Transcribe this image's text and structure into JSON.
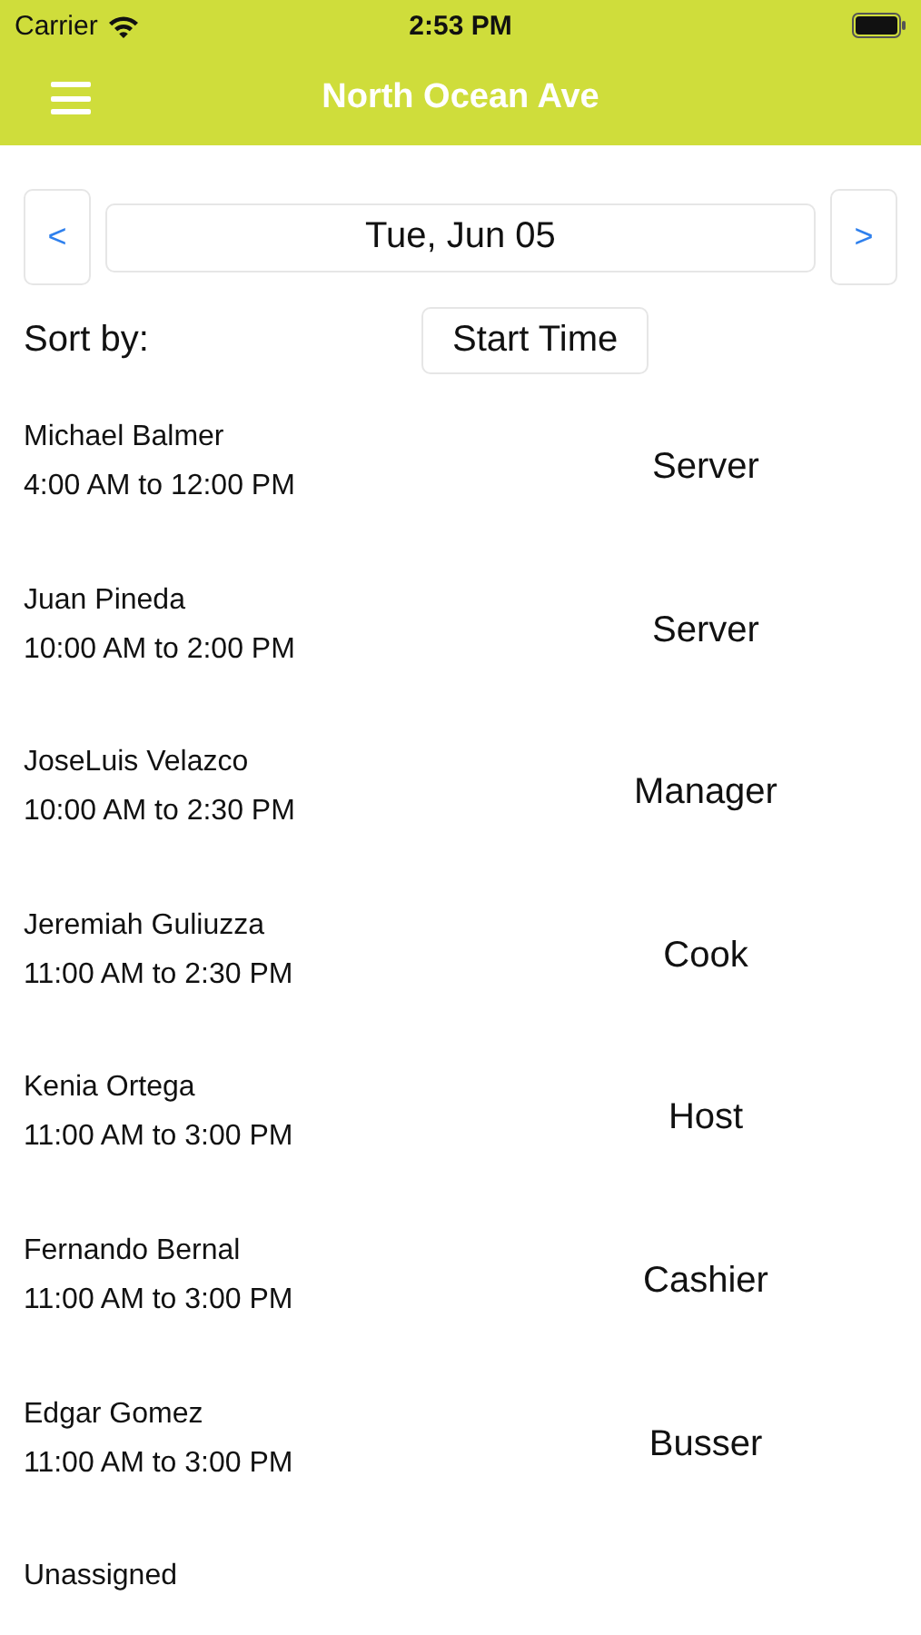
{
  "status_bar": {
    "carrier": "Carrier",
    "time": "2:53 PM"
  },
  "header": {
    "title": "North Ocean Ave"
  },
  "date_nav": {
    "prev": "<",
    "date": "Tue, Jun 05",
    "next": ">"
  },
  "sort": {
    "label": "Sort by:",
    "value": "Start Time"
  },
  "shifts": [
    {
      "name": "Michael Balmer",
      "time": "4:00 AM to 12:00 PM",
      "role": "Server"
    },
    {
      "name": "Juan Pineda",
      "time": "10:00 AM to 2:00 PM",
      "role": "Server"
    },
    {
      "name": "JoseLuis Velazco",
      "time": "10:00 AM to 2:30 PM",
      "role": "Manager"
    },
    {
      "name": "Jeremiah Guliuzza",
      "time": "11:00 AM to 2:30 PM",
      "role": "Cook"
    },
    {
      "name": "Kenia Ortega",
      "time": "11:00 AM to 3:00 PM",
      "role": "Host"
    },
    {
      "name": "Fernando Bernal",
      "time": "11:00 AM to 3:00 PM",
      "role": "Cashier"
    },
    {
      "name": "Edgar Gomez",
      "time": "11:00 AM to 3:00 PM",
      "role": "Busser"
    },
    {
      "name": "Unassigned"
    }
  ]
}
